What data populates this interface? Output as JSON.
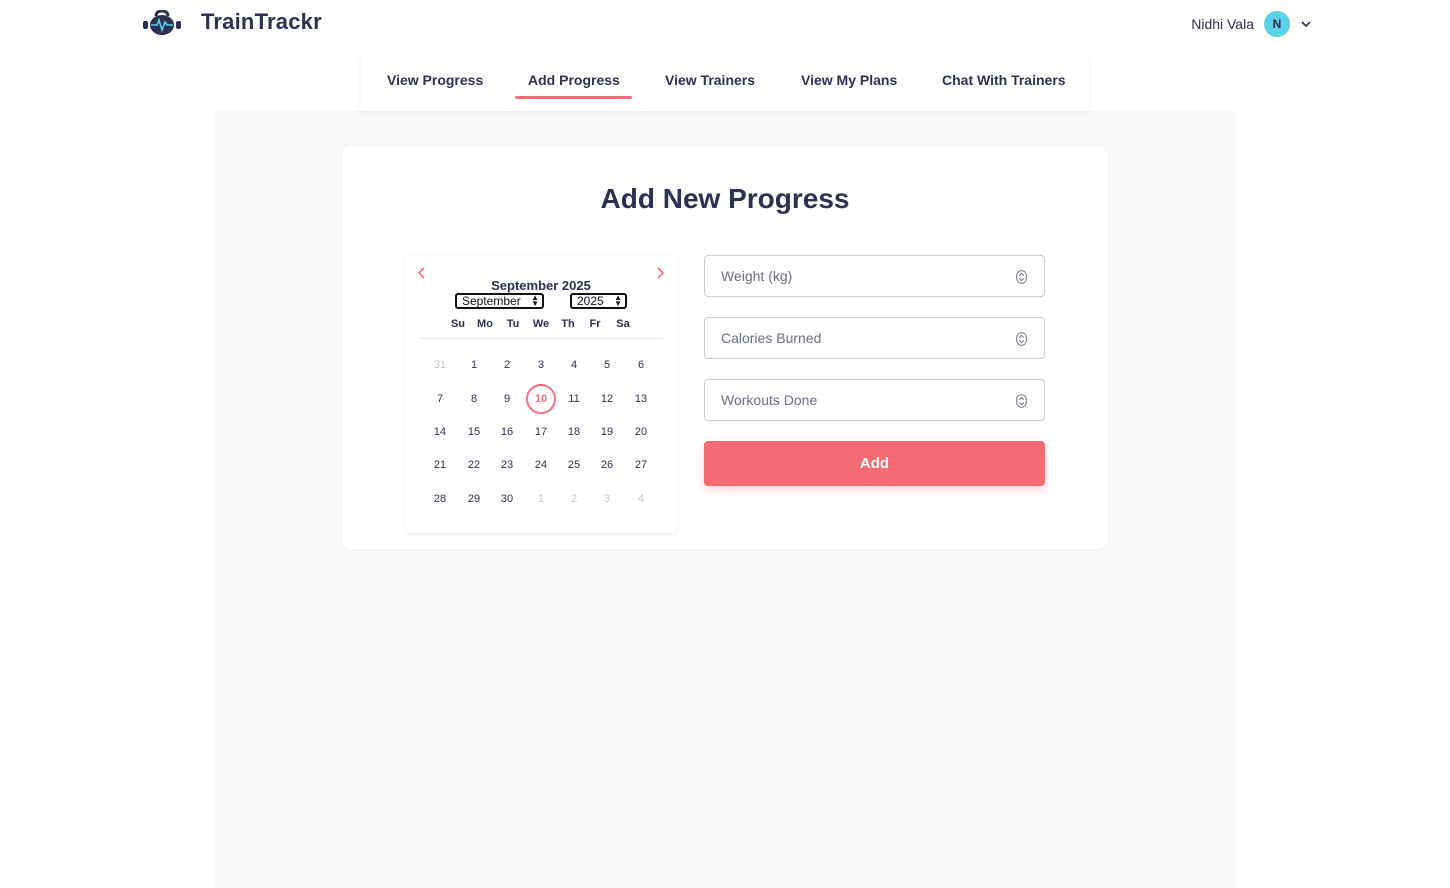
{
  "app": {
    "name": "TrainTrackr"
  },
  "user": {
    "name": "Nidhi Vala",
    "initial": "N"
  },
  "nav": {
    "tabs": [
      {
        "label": "View Progress"
      },
      {
        "label": "Add Progress",
        "active": true
      },
      {
        "label": "View Trainers"
      },
      {
        "label": "View My Plans"
      },
      {
        "label": "Chat With Trainers"
      }
    ]
  },
  "form": {
    "title": "Add New Progress",
    "weight_placeholder": "Weight (kg)",
    "calories_placeholder": "Calories Burned",
    "workouts_placeholder": "Workouts Done",
    "add_label": "Add"
  },
  "calendar": {
    "month_title": "September 2025",
    "month_select": "September",
    "year_select": "2025",
    "weekdays": [
      "Su",
      "Mo",
      "Tu",
      "We",
      "Th",
      "Fr",
      "Sa"
    ],
    "weeks": [
      [
        "31",
        "1",
        "2",
        "3",
        "4",
        "5",
        "6"
      ],
      [
        "7",
        "8",
        "9",
        "10",
        "11",
        "12",
        "13"
      ],
      [
        "14",
        "15",
        "16",
        "17",
        "18",
        "19",
        "20"
      ],
      [
        "21",
        "22",
        "23",
        "24",
        "25",
        "26",
        "27"
      ],
      [
        "28",
        "29",
        "30",
        "1",
        "2",
        "3",
        "4"
      ]
    ],
    "selected_day": "10"
  },
  "colors": {
    "accent": "#f46b74",
    "brand_text": "#2d3150",
    "avatar_bg": "#5ad3e8",
    "content_bg": "#f7f8fa"
  },
  "icons": {
    "logo": "kettlebell-heartbeat-icon",
    "user_menu": "chevron-down-icon",
    "prev": "chevron-left-icon",
    "next": "chevron-right-icon",
    "spinner": "number-spinner-icon"
  }
}
